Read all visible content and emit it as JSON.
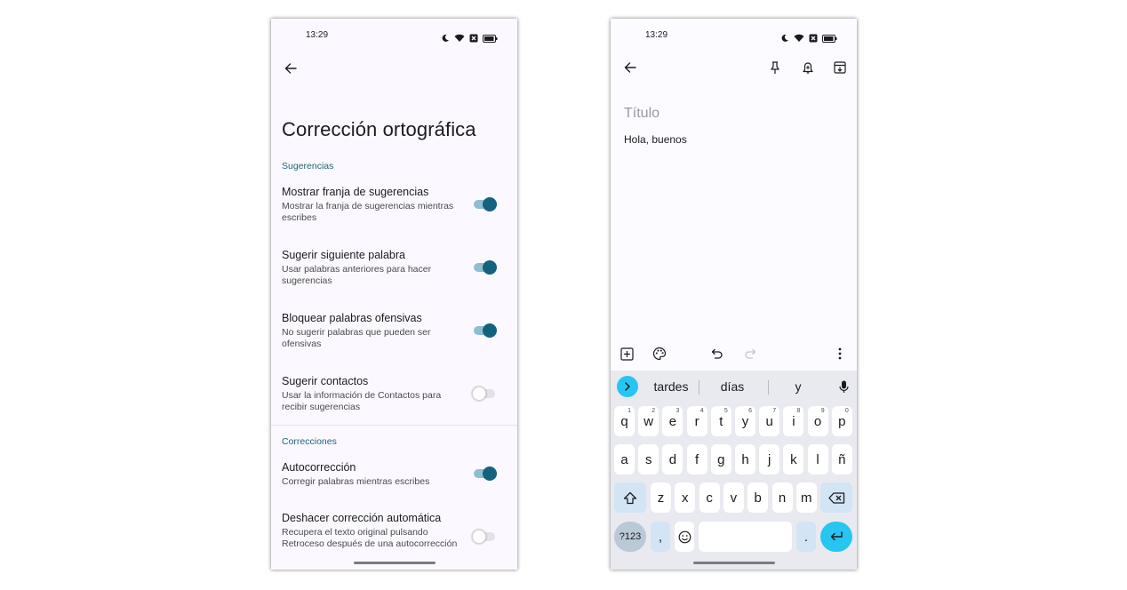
{
  "left_phone": {
    "status_time": "13:29",
    "title": "Corrección ortográfica",
    "sections": [
      {
        "header": "Sugerencias",
        "items": [
          {
            "title": "Mostrar franja de sugerencias",
            "desc": "Mostrar la franja de sugerencias mientras escribes",
            "on": true
          },
          {
            "title": "Sugerir siguiente palabra",
            "desc": "Usar palabras anteriores para hacer sugerencias",
            "on": true
          },
          {
            "title": "Bloquear palabras ofensivas",
            "desc": "No sugerir palabras que pueden ser ofensivas",
            "on": true
          },
          {
            "title": "Sugerir contactos",
            "desc": "Usar la información de Contactos para recibir sugerencias",
            "on": false
          }
        ]
      },
      {
        "header": "Correcciones",
        "items": [
          {
            "title": "Autocorrección",
            "desc": "Corregir palabras mientras escribes",
            "on": true
          },
          {
            "title": "Deshacer corrección automática",
            "desc": "Recupera el texto original pulsando Retroceso después de una autocorrección",
            "on": false
          }
        ]
      }
    ]
  },
  "right_phone": {
    "status_time": "13:29",
    "note": {
      "title_placeholder": "Título",
      "body": "Hola, buenos"
    },
    "keyboard": {
      "suggestions": [
        "tardes",
        "días",
        "y"
      ],
      "row1": [
        {
          "k": "q",
          "h": "1"
        },
        {
          "k": "w",
          "h": "2"
        },
        {
          "k": "e",
          "h": "3"
        },
        {
          "k": "r",
          "h": "4"
        },
        {
          "k": "t",
          "h": "5"
        },
        {
          "k": "y",
          "h": "6"
        },
        {
          "k": "u",
          "h": "7"
        },
        {
          "k": "i",
          "h": "8"
        },
        {
          "k": "o",
          "h": "9"
        },
        {
          "k": "p",
          "h": "0"
        }
      ],
      "row2": [
        "a",
        "s",
        "d",
        "f",
        "g",
        "h",
        "j",
        "k",
        "l",
        "ñ"
      ],
      "row3": [
        "z",
        "x",
        "c",
        "v",
        "b",
        "n",
        "m"
      ],
      "symbols_key": "?123",
      "comma_key": ",",
      "period_key": "."
    }
  },
  "colors": {
    "accent": "#13637e",
    "switch_track_on": "#8fbed0",
    "section_header": "#1f6478",
    "keyboard_bg": "#e8eaf0",
    "keyboard_accent": "#27c6f2"
  },
  "icons": {
    "status": [
      "moon-icon",
      "wifi-icon",
      "notification-x-icon",
      "battery-icon"
    ],
    "notes_toolbar": [
      "back-arrow-icon",
      "pin-icon",
      "add-alarm-icon",
      "archive-icon"
    ],
    "notes_bottom": [
      "add-box-icon",
      "palette-icon",
      "undo-icon",
      "redo-icon",
      "more-vert-icon"
    ],
    "keyboard": [
      "chevron-right-icon",
      "mic-icon",
      "shift-icon",
      "backspace-icon",
      "emoji-icon",
      "enter-icon"
    ]
  }
}
